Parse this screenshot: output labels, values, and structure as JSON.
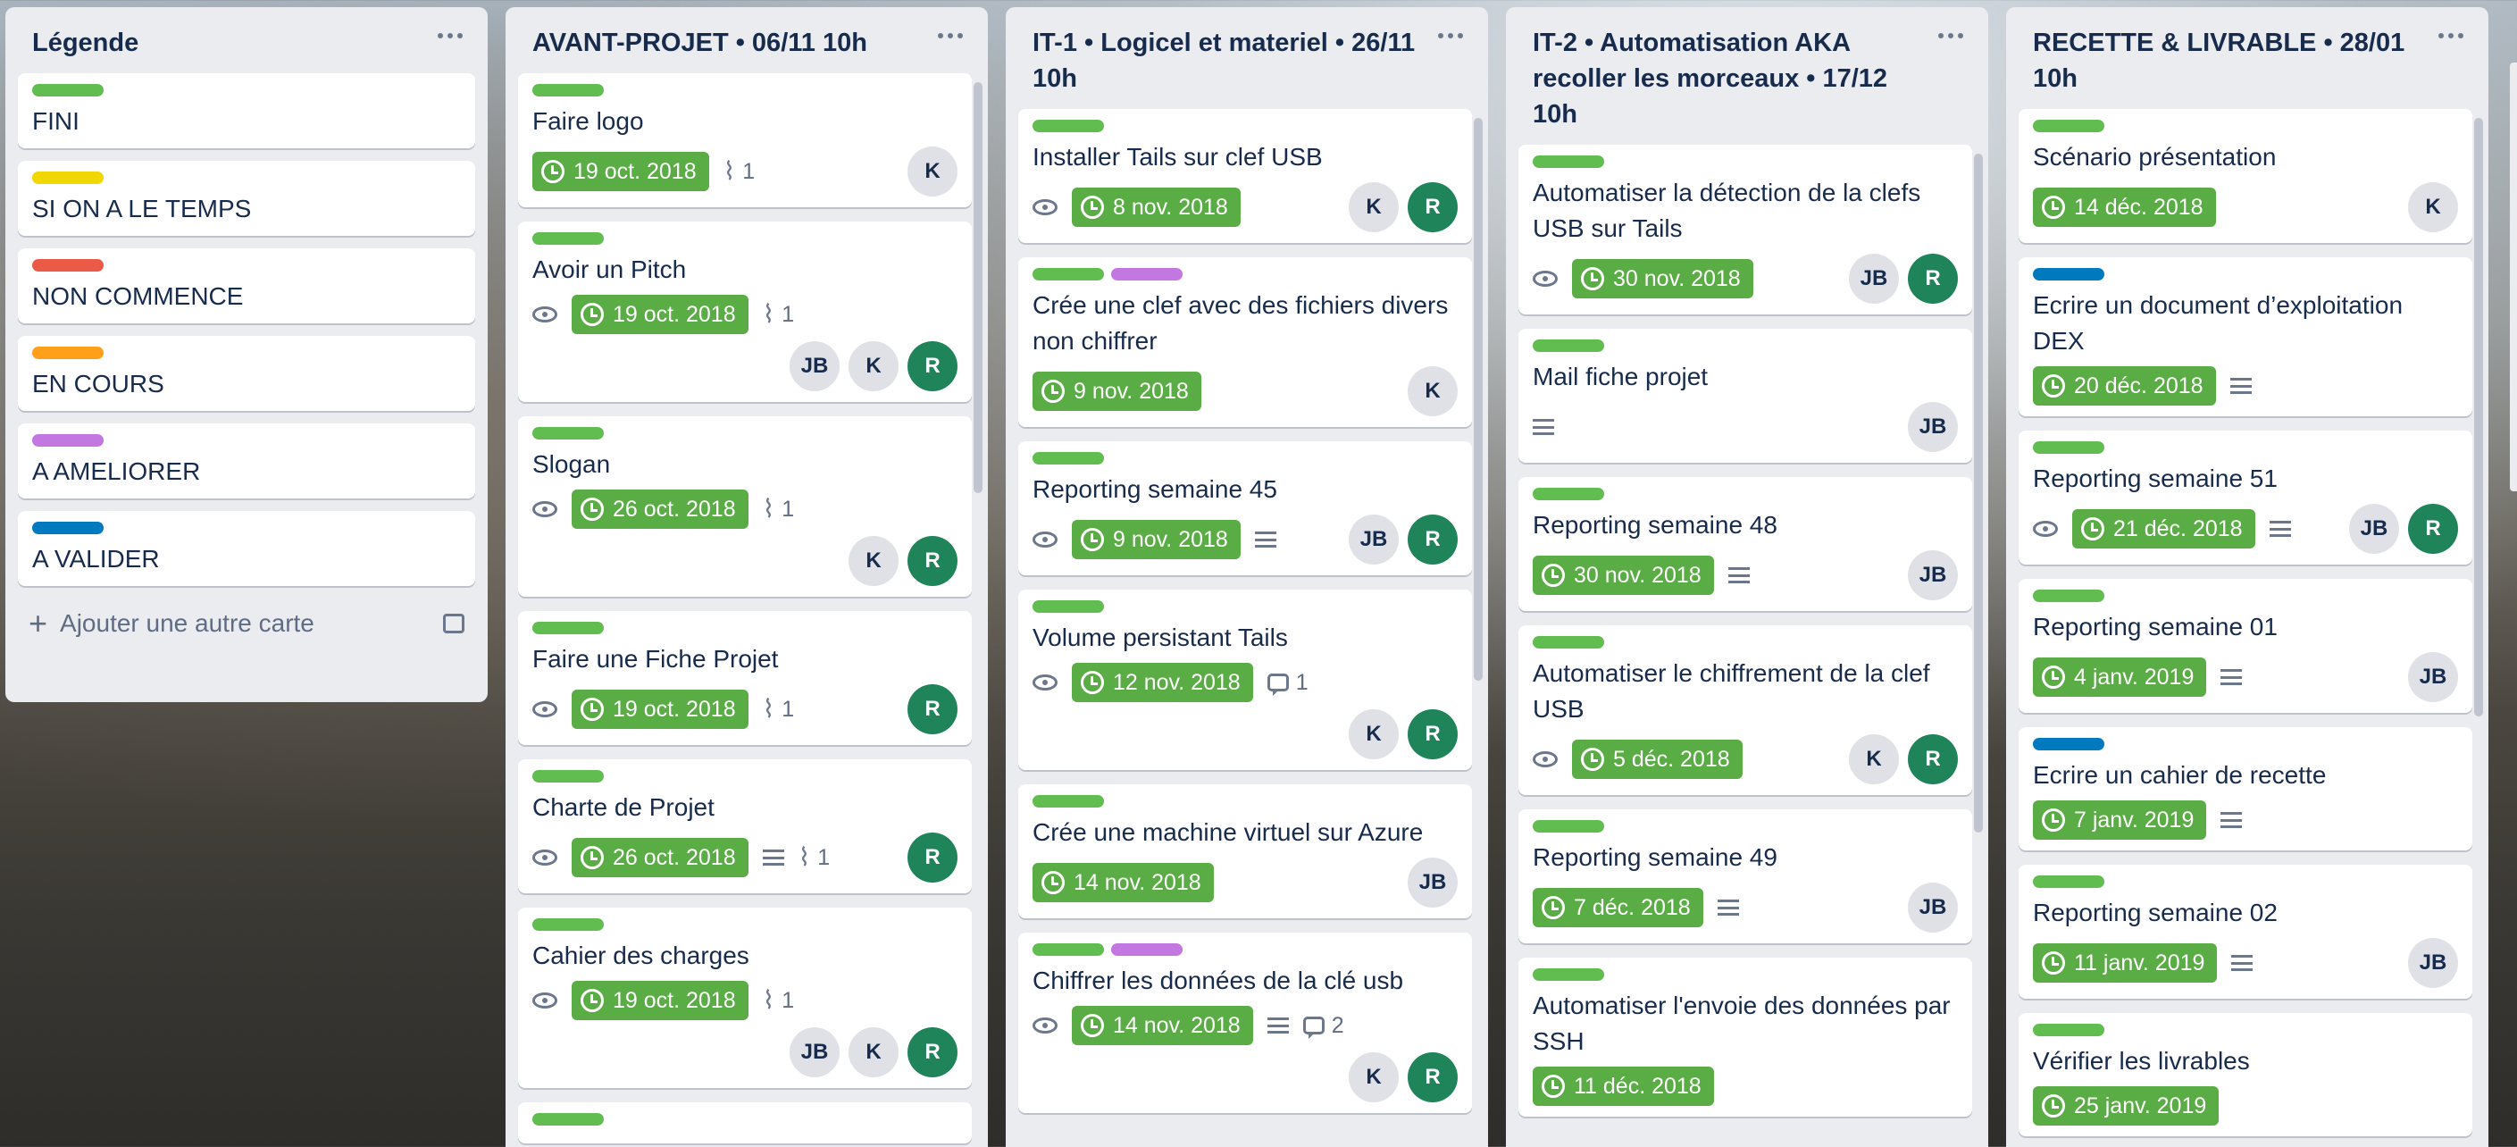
{
  "labels_palette": {
    "green": "#61bd4f",
    "yellow": "#f2d600",
    "red": "#eb5a46",
    "orange": "#ff9f1a",
    "purple": "#c377e0",
    "blue": "#0079bf"
  },
  "lists": [
    {
      "title": "Légende",
      "add_card_label": "Ajouter une autre carte",
      "cards": [
        {
          "labels": [
            "green"
          ],
          "title": "FINI"
        },
        {
          "labels": [
            "yellow"
          ],
          "title": "SI ON A LE TEMPS"
        },
        {
          "labels": [
            "red"
          ],
          "title": "NON COMMENCE"
        },
        {
          "labels": [
            "orange"
          ],
          "title": "EN COURS"
        },
        {
          "labels": [
            "purple"
          ],
          "title": "A AMELIORER"
        },
        {
          "labels": [
            "blue"
          ],
          "title": "A VALIDER"
        }
      ]
    },
    {
      "title": "AVANT-PROJET • 06/11 10h",
      "cards": [
        {
          "labels": [
            "green"
          ],
          "title": "Faire logo",
          "due": "19 oct. 2018",
          "attachments": "1",
          "members": [
            "K"
          ],
          "members_inline": true
        },
        {
          "labels": [
            "green"
          ],
          "title": "Avoir un Pitch",
          "watch": true,
          "due": "19 oct. 2018",
          "attachments": "1",
          "members": [
            "JB",
            "K",
            "R"
          ]
        },
        {
          "labels": [
            "green"
          ],
          "title": "Slogan",
          "watch": true,
          "due": "26 oct. 2018",
          "attachments": "1",
          "members": [
            "K",
            "R"
          ]
        },
        {
          "labels": [
            "green"
          ],
          "title": "Faire une Fiche Projet",
          "watch": true,
          "due": "19 oct. 2018",
          "attachments": "1",
          "members": [
            "R"
          ],
          "members_inline": true
        },
        {
          "labels": [
            "green"
          ],
          "title": "Charte de Projet",
          "watch": true,
          "due": "26 oct. 2018",
          "description": true,
          "attachments": "1",
          "members": [
            "R"
          ],
          "members_inline": true
        },
        {
          "labels": [
            "green"
          ],
          "title": "Cahier des charges",
          "watch": true,
          "due": "19 oct. 2018",
          "attachments": "1",
          "members": [
            "JB",
            "K",
            "R"
          ]
        },
        {
          "labels": [
            "green"
          ],
          "title": ""
        }
      ]
    },
    {
      "title": "IT-1 • Logicel et materiel • 26/11 10h",
      "cards": [
        {
          "labels": [
            "green"
          ],
          "title": "Installer Tails sur clef USB",
          "watch": true,
          "due": "8 nov. 2018",
          "members": [
            "K",
            "R"
          ],
          "members_inline": true
        },
        {
          "labels": [
            "green",
            "purple"
          ],
          "title": "Crée une clef avec des fichiers divers non chiffrer",
          "due": "9 nov. 2018",
          "members": [
            "K"
          ],
          "members_inline": true
        },
        {
          "labels": [
            "green"
          ],
          "title": "Reporting semaine 45",
          "watch": true,
          "due": "9 nov. 2018",
          "description": true,
          "members": [
            "JB",
            "R"
          ],
          "members_inline": true
        },
        {
          "labels": [
            "green"
          ],
          "title": "Volume persistant Tails",
          "watch": true,
          "due": "12 nov. 2018",
          "comments": "1",
          "members": [
            "K",
            "R"
          ]
        },
        {
          "labels": [
            "green"
          ],
          "title": "Crée une machine virtuel sur Azure",
          "due": "14 nov. 2018",
          "members": [
            "JB"
          ],
          "members_inline": true
        },
        {
          "labels": [
            "green",
            "purple"
          ],
          "title": "Chiffrer les données de la clé usb",
          "watch": true,
          "due": "14 nov. 2018",
          "description": true,
          "comments": "2",
          "members": [
            "K",
            "R"
          ]
        }
      ]
    },
    {
      "title": "IT-2 • Automatisation AKA recoller les morceaux • 17/12 10h",
      "cards": [
        {
          "labels": [
            "green"
          ],
          "title": "Automatiser la détection de la clefs USB sur Tails",
          "watch": true,
          "due": "30 nov. 2018",
          "members": [
            "JB",
            "R"
          ],
          "members_inline": true
        },
        {
          "labels": [
            "green"
          ],
          "title": "Mail fiche projet",
          "description": true,
          "members": [
            "JB"
          ],
          "members_inline": true
        },
        {
          "labels": [
            "green"
          ],
          "title": "Reporting semaine 48",
          "due": "30 nov. 2018",
          "description": true,
          "members": [
            "JB"
          ],
          "members_inline": true
        },
        {
          "labels": [
            "green"
          ],
          "title": "Automatiser le chiffrement de la clef USB",
          "watch": true,
          "due": "5 déc. 2018",
          "members": [
            "K",
            "R"
          ],
          "members_inline": true
        },
        {
          "labels": [
            "green"
          ],
          "title": "Reporting semaine 49",
          "due": "7 déc. 2018",
          "description": true,
          "members": [
            "JB"
          ],
          "members_inline": true
        },
        {
          "labels": [
            "green"
          ],
          "title": "Automatiser l'envoie des données par SSH",
          "due": "11 déc. 2018"
        }
      ]
    },
    {
      "title": "RECETTE & LIVRABLE • 28/01 10h",
      "cards": [
        {
          "labels": [
            "green"
          ],
          "title": "Scénario présentation",
          "due": "14 déc. 2018",
          "members": [
            "K"
          ],
          "members_inline": true
        },
        {
          "labels": [
            "blue"
          ],
          "title": "Ecrire un document d’exploitation DEX",
          "due": "20 déc. 2018",
          "description": true
        },
        {
          "labels": [
            "green"
          ],
          "title": "Reporting semaine 51",
          "watch": true,
          "due": "21 déc. 2018",
          "description": true,
          "members": [
            "JB",
            "R"
          ],
          "members_inline": true
        },
        {
          "labels": [
            "green"
          ],
          "title": "Reporting semaine 01",
          "due": "4 janv. 2019",
          "description": true,
          "members": [
            "JB"
          ],
          "members_inline": true
        },
        {
          "labels": [
            "blue"
          ],
          "title": "Ecrire un cahier de recette",
          "due": "7 janv. 2019",
          "description": true
        },
        {
          "labels": [
            "green"
          ],
          "title": "Reporting semaine 02",
          "due": "11 janv. 2019",
          "description": true,
          "members": [
            "JB"
          ],
          "members_inline": true
        },
        {
          "labels": [
            "green"
          ],
          "title": "Vérifier les livrables",
          "due": "25 janv. 2019"
        }
      ]
    }
  ]
}
